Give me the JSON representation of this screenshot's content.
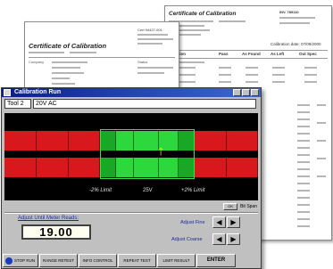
{
  "doc_back": {
    "title": "Certificate of Calibration",
    "header_right": "INV. 789110",
    "heads": [
      "Function",
      "Pass",
      "As Found",
      "As Left",
      "Out Spec"
    ],
    "block_label": "Calibration date: 07/09/2000"
  },
  "doc_front": {
    "title": "Certificate of Calibration",
    "header_right": "Cert 94427-001",
    "sub_left": "Company",
    "sub_right": "Status"
  },
  "window": {
    "title": "Calibration Run",
    "tool_id": "Tool 2",
    "tool_name": "20V AC"
  },
  "gauge": {
    "label_low": "-2% Limit",
    "label_center": "25V",
    "label_high": "+2% Limit",
    "zero_btn": "OK",
    "zero_label": "Bit Span"
  },
  "adjust": {
    "label": "Adjust Until Meter Reads:",
    "reading": "19.00",
    "fine_label": "Adjust Fine",
    "coarse_label": "Adjust Coarse",
    "left_arrow": "◀",
    "right_arrow": "▶"
  },
  "buttons": {
    "stop": "STOP RUN",
    "retest": "RANGE RETEST",
    "control": "INFO CONTROL",
    "test": "REPEAT TEST",
    "result": "LIMIT RESULT",
    "enter": "ENTER"
  },
  "colors": {
    "titlebar": "#0a1e8c",
    "gauge_bg": "#000000",
    "band_red": "#d8181c",
    "band_green": "#18a826",
    "band_green_center": "#2cd83c",
    "needle": "#ffe000"
  }
}
